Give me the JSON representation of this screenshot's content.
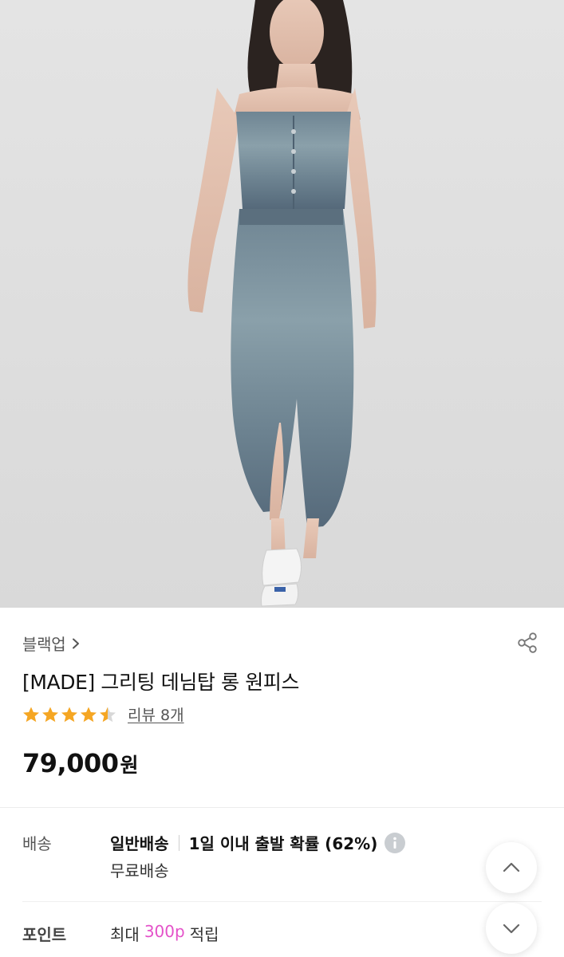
{
  "product": {
    "brand": "블랙업",
    "title": "[MADE] 그리팅 데님탑 롱 원피스",
    "rating": 4.5,
    "review_link": "리뷰 8개",
    "price_amount": "79,000",
    "price_unit": "원"
  },
  "delivery": {
    "label": "배송",
    "type": "일반배송",
    "dispatch": "1일 이내 출발 확률 (62%)",
    "fee": "무료배송"
  },
  "point": {
    "label": "포인트",
    "prefix": "최대",
    "amount": "300p",
    "suffix": "적립"
  },
  "colors": {
    "star": "#f5a623",
    "star_empty": "#d8d8d8",
    "point_accent": "#e452c9"
  },
  "icons": [
    "chevron-right-icon",
    "share-icon",
    "star-icon",
    "info-icon",
    "chevron-up-icon",
    "chevron-down-icon"
  ]
}
